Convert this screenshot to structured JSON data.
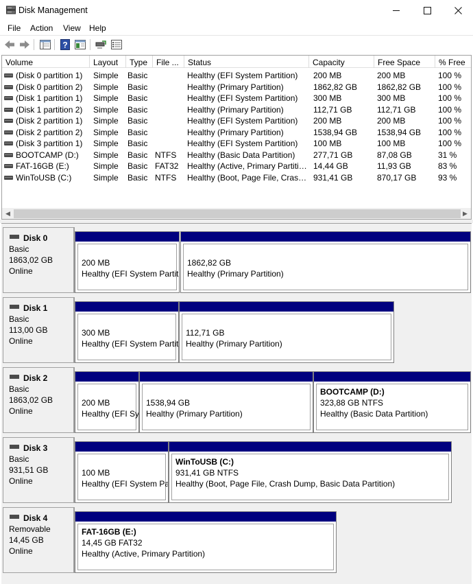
{
  "window": {
    "title": "Disk Management",
    "minimize": "—",
    "maximize": "☐",
    "close": "✕"
  },
  "menu": [
    "File",
    "Action",
    "View",
    "Help"
  ],
  "volume_table": {
    "headers": [
      "Volume",
      "Layout",
      "Type",
      "File ...",
      "Status",
      "Capacity",
      "Free Space",
      "% Free"
    ],
    "rows": [
      [
        "(Disk 0 partition 1)",
        "Simple",
        "Basic",
        "",
        "Healthy (EFI System Partition)",
        "200 MB",
        "200 MB",
        "100 %"
      ],
      [
        "(Disk 0 partition 2)",
        "Simple",
        "Basic",
        "",
        "Healthy (Primary Partition)",
        "1862,82 GB",
        "1862,82 GB",
        "100 %"
      ],
      [
        "(Disk 1 partition 1)",
        "Simple",
        "Basic",
        "",
        "Healthy (EFI System Partition)",
        "300 MB",
        "300 MB",
        "100 %"
      ],
      [
        "(Disk 1 partition 2)",
        "Simple",
        "Basic",
        "",
        "Healthy (Primary Partition)",
        "112,71 GB",
        "112,71 GB",
        "100 %"
      ],
      [
        "(Disk 2 partition 1)",
        "Simple",
        "Basic",
        "",
        "Healthy (EFI System Partition)",
        "200 MB",
        "200 MB",
        "100 %"
      ],
      [
        "(Disk 2 partition 2)",
        "Simple",
        "Basic",
        "",
        "Healthy (Primary Partition)",
        "1538,94 GB",
        "1538,94 GB",
        "100 %"
      ],
      [
        "(Disk 3 partition 1)",
        "Simple",
        "Basic",
        "",
        "Healthy (EFI System Partition)",
        "100 MB",
        "100 MB",
        "100 %"
      ],
      [
        "BOOTCAMP (D:)",
        "Simple",
        "Basic",
        "NTFS",
        "Healthy (Basic Data Partition)",
        "277,71 GB",
        "87,08 GB",
        "31 %"
      ],
      [
        "FAT-16GB (E:)",
        "Simple",
        "Basic",
        "FAT32",
        "Healthy (Active, Primary Partitio...",
        "14,44 GB",
        "11,93 GB",
        "83 %"
      ],
      [
        "WinToUSB (C:)",
        "Simple",
        "Basic",
        "NTFS",
        "Healthy (Boot, Page File, Crash ...",
        "931,41 GB",
        "870,17 GB",
        "93 %"
      ]
    ]
  },
  "disks": [
    {
      "name": "Disk 0",
      "type": "Basic",
      "size": "1863,02 GB",
      "state": "Online",
      "partitions": [
        {
          "title": "",
          "size": "200 MB",
          "status": "Healthy (EFI System Partitic"
        },
        {
          "title": "",
          "size": "1862,82 GB",
          "status": "Healthy (Primary Partition)"
        }
      ]
    },
    {
      "name": "Disk 1",
      "type": "Basic",
      "size": "113,00 GB",
      "state": "Online",
      "partitions": [
        {
          "title": "",
          "size": "300 MB",
          "status": "Healthy (EFI System Partitic"
        },
        {
          "title": "",
          "size": "112,71 GB",
          "status": "Healthy (Primary Partition)"
        }
      ]
    },
    {
      "name": "Disk 2",
      "type": "Basic",
      "size": "1863,02 GB",
      "state": "Online",
      "partitions": [
        {
          "title": "",
          "size": "200 MB",
          "status": "Healthy (EFI Sy:"
        },
        {
          "title": "",
          "size": "1538,94 GB",
          "status": "Healthy (Primary Partition)"
        },
        {
          "title": "BOOTCAMP  (D:)",
          "size": "323,88 GB NTFS",
          "status": "Healthy (Basic Data Partition)"
        }
      ]
    },
    {
      "name": "Disk 3",
      "type": "Basic",
      "size": "931,51 GB",
      "state": "Online",
      "partitions": [
        {
          "title": "",
          "size": "100 MB",
          "status": "Healthy (EFI System Par"
        },
        {
          "title": "WinToUSB  (C:)",
          "size": "931,41 GB NTFS",
          "status": "Healthy (Boot, Page File, Crash Dump, Basic Data Partition)"
        }
      ]
    },
    {
      "name": "Disk 4",
      "type": "Removable",
      "size": "14,45 GB",
      "state": "Online",
      "partitions": [
        {
          "title": "FAT-16GB  (E:)",
          "size": "14,45 GB FAT32",
          "status": "Healthy (Active, Primary Partition)"
        }
      ]
    }
  ],
  "icons": {
    "back": "back-arrow-icon",
    "forward": "forward-arrow-icon",
    "properties": "console-tree-icon",
    "help": "help-icon",
    "show_hide": "show-hide-pane-icon",
    "connect": "connect-icon",
    "list": "list-view-icon"
  }
}
